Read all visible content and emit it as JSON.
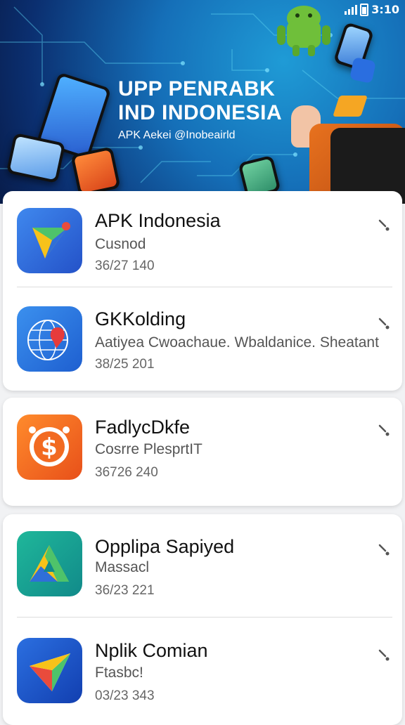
{
  "status_bar": {
    "time": "3:10"
  },
  "banner": {
    "title_line1": "UPP PENRABK",
    "title_line2": "IND INDONESIA",
    "subtitle": "APK Aekei @Inobeairld"
  },
  "apps": [
    {
      "name": "APK Indonesia",
      "description": "Cusnod",
      "meta": "36/27  140",
      "icon": "send-arrow-icon",
      "color": "#2f6fd8"
    },
    {
      "name": "GKKolding",
      "description": "Aatiyea Cwoachaue. Wbaldanice. Sheatant",
      "meta": "38/25  201",
      "icon": "globe-pin-icon",
      "color": "#2a78d8"
    },
    {
      "name": "FadlycDkfe",
      "description": "Cosrre PlesprtIT",
      "meta": "36726  240",
      "icon": "dollar-coin-icon",
      "color": "#f26a21"
    },
    {
      "name": "Opplipa Sapiyed",
      "description": "Massacl",
      "meta": "36/23  221",
      "icon": "triangle-a-icon",
      "color": "#14a58f"
    },
    {
      "name": "Nplik Comian",
      "description": "Ftasbc!",
      "meta": "03/23  343",
      "icon": "paper-plane-icon",
      "color": "#1e56c8"
    }
  ]
}
